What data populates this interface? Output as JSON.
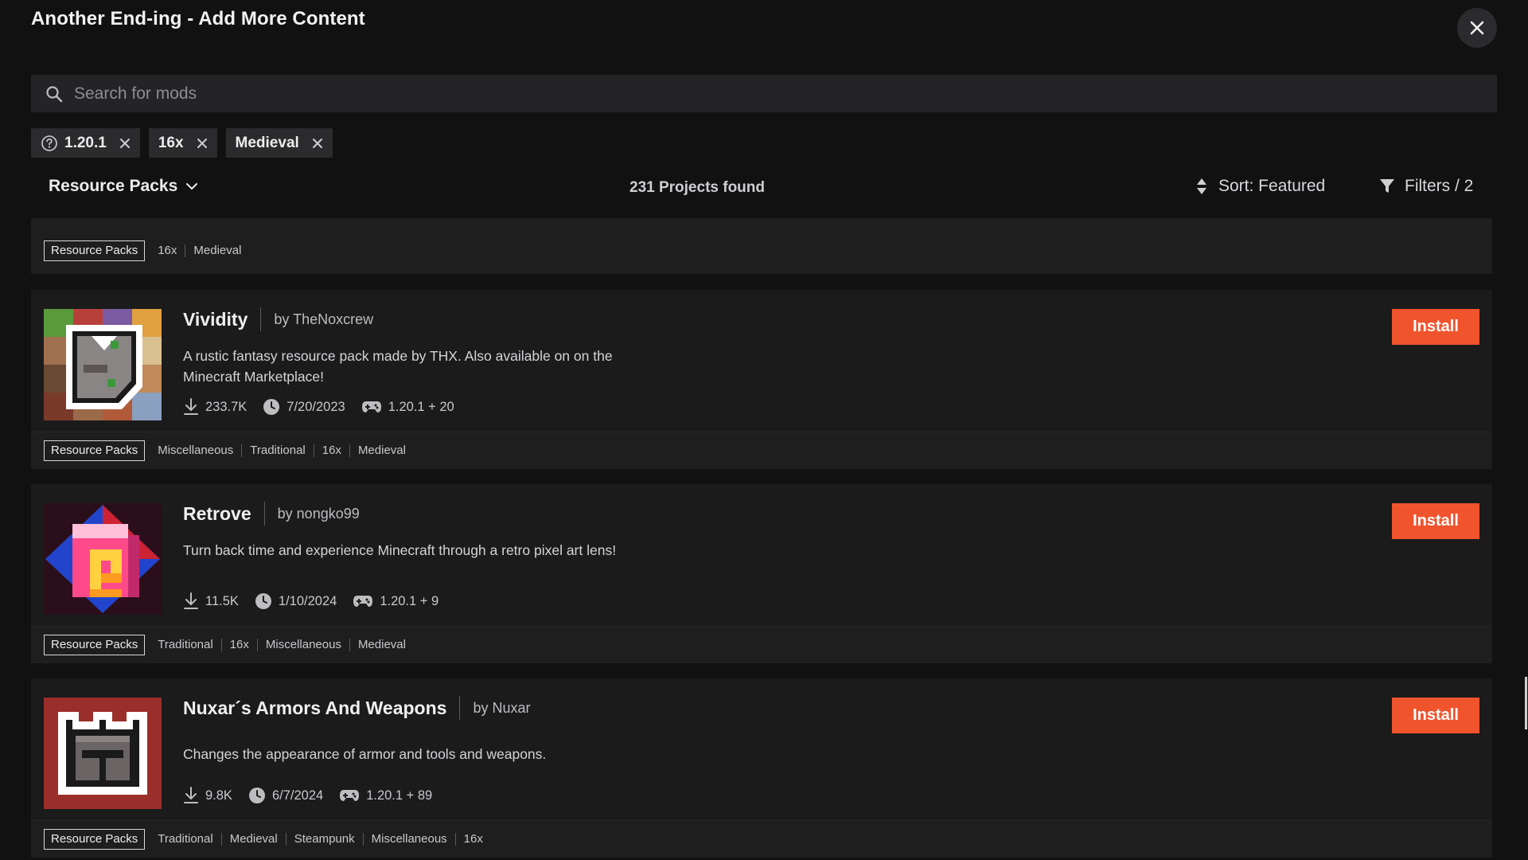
{
  "window": {
    "title": "Another End-ing - Add More Content"
  },
  "search": {
    "placeholder": "Search for mods"
  },
  "chips": [
    {
      "label": "1.20.1",
      "icon": "question-circle-icon"
    },
    {
      "label": "16x"
    },
    {
      "label": "Medieval"
    }
  ],
  "toolbar": {
    "content_type": "Resource Packs",
    "projects_found": "231 Projects found",
    "sort_label": "Sort: Featured",
    "filters_label": "Filters / 2"
  },
  "partial_card": {
    "badge": "Resource Packs",
    "tags": [
      "16x",
      "Medieval"
    ]
  },
  "projects": [
    {
      "name": "Vividity",
      "author": "by TheNoxcrew",
      "description": "A rustic fantasy resource pack made by THX. Also available on on the Minecraft Marketplace!",
      "downloads": "233.7K",
      "updated": "7/20/2023",
      "versions": "1.20.1 + 20",
      "install_label": "Install",
      "badge": "Resource Packs",
      "tags": [
        "Miscellaneous",
        "Traditional",
        "16x",
        "Medieval"
      ]
    },
    {
      "name": "Retrove",
      "author": "by nongko99",
      "description": "Turn back time and experience Minecraft through a retro pixel art lens!",
      "downloads": "11.5K",
      "updated": "1/10/2024",
      "versions": "1.20.1 + 9",
      "install_label": "Install",
      "badge": "Resource Packs",
      "tags": [
        "Traditional",
        "16x",
        "Miscellaneous",
        "Medieval"
      ]
    },
    {
      "name": "Nuxar´s Armors And Weapons",
      "author": "by Nuxar",
      "description": "Changes the appearance of armor and tools and weapons.",
      "downloads": "9.8K",
      "updated": "6/7/2024",
      "versions": "1.20.1 + 89",
      "install_label": "Install",
      "badge": "Resource Packs",
      "tags": [
        "Traditional",
        "Medieval",
        "Steampunk",
        "Miscellaneous",
        "16x"
      ]
    }
  ],
  "colors": {
    "accent": "#f0542d",
    "background": "#111112",
    "card": "#1b1b1c"
  }
}
